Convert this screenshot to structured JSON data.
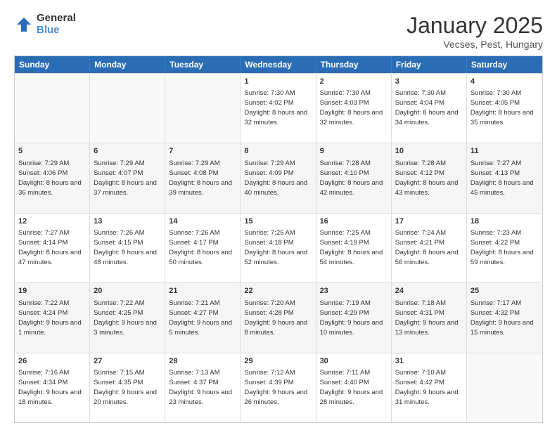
{
  "header": {
    "logo_general": "General",
    "logo_blue": "Blue",
    "month_title": "January 2025",
    "location": "Vecses, Pest, Hungary"
  },
  "days_of_week": [
    "Sunday",
    "Monday",
    "Tuesday",
    "Wednesday",
    "Thursday",
    "Friday",
    "Saturday"
  ],
  "weeks": [
    [
      {
        "day": "",
        "text": ""
      },
      {
        "day": "",
        "text": ""
      },
      {
        "day": "",
        "text": ""
      },
      {
        "day": "1",
        "text": "Sunrise: 7:30 AM\nSunset: 4:02 PM\nDaylight: 8 hours and 32 minutes."
      },
      {
        "day": "2",
        "text": "Sunrise: 7:30 AM\nSunset: 4:03 PM\nDaylight: 8 hours and 32 minutes."
      },
      {
        "day": "3",
        "text": "Sunrise: 7:30 AM\nSunset: 4:04 PM\nDaylight: 8 hours and 34 minutes."
      },
      {
        "day": "4",
        "text": "Sunrise: 7:30 AM\nSunset: 4:05 PM\nDaylight: 8 hours and 35 minutes."
      }
    ],
    [
      {
        "day": "5",
        "text": "Sunrise: 7:29 AM\nSunset: 4:06 PM\nDaylight: 8 hours and 36 minutes."
      },
      {
        "day": "6",
        "text": "Sunrise: 7:29 AM\nSunset: 4:07 PM\nDaylight: 8 hours and 37 minutes."
      },
      {
        "day": "7",
        "text": "Sunrise: 7:29 AM\nSunset: 4:08 PM\nDaylight: 8 hours and 39 minutes."
      },
      {
        "day": "8",
        "text": "Sunrise: 7:29 AM\nSunset: 4:09 PM\nDaylight: 8 hours and 40 minutes."
      },
      {
        "day": "9",
        "text": "Sunrise: 7:28 AM\nSunset: 4:10 PM\nDaylight: 8 hours and 42 minutes."
      },
      {
        "day": "10",
        "text": "Sunrise: 7:28 AM\nSunset: 4:12 PM\nDaylight: 8 hours and 43 minutes."
      },
      {
        "day": "11",
        "text": "Sunrise: 7:27 AM\nSunset: 4:13 PM\nDaylight: 8 hours and 45 minutes."
      }
    ],
    [
      {
        "day": "12",
        "text": "Sunrise: 7:27 AM\nSunset: 4:14 PM\nDaylight: 8 hours and 47 minutes."
      },
      {
        "day": "13",
        "text": "Sunrise: 7:26 AM\nSunset: 4:15 PM\nDaylight: 8 hours and 48 minutes."
      },
      {
        "day": "14",
        "text": "Sunrise: 7:26 AM\nSunset: 4:17 PM\nDaylight: 8 hours and 50 minutes."
      },
      {
        "day": "15",
        "text": "Sunrise: 7:25 AM\nSunset: 4:18 PM\nDaylight: 8 hours and 52 minutes."
      },
      {
        "day": "16",
        "text": "Sunrise: 7:25 AM\nSunset: 4:19 PM\nDaylight: 8 hours and 54 minutes."
      },
      {
        "day": "17",
        "text": "Sunrise: 7:24 AM\nSunset: 4:21 PM\nDaylight: 8 hours and 56 minutes."
      },
      {
        "day": "18",
        "text": "Sunrise: 7:23 AM\nSunset: 4:22 PM\nDaylight: 8 hours and 59 minutes."
      }
    ],
    [
      {
        "day": "19",
        "text": "Sunrise: 7:22 AM\nSunset: 4:24 PM\nDaylight: 9 hours and 1 minute."
      },
      {
        "day": "20",
        "text": "Sunrise: 7:22 AM\nSunset: 4:25 PM\nDaylight: 9 hours and 3 minutes."
      },
      {
        "day": "21",
        "text": "Sunrise: 7:21 AM\nSunset: 4:27 PM\nDaylight: 9 hours and 5 minutes."
      },
      {
        "day": "22",
        "text": "Sunrise: 7:20 AM\nSunset: 4:28 PM\nDaylight: 9 hours and 8 minutes."
      },
      {
        "day": "23",
        "text": "Sunrise: 7:19 AM\nSunset: 4:29 PM\nDaylight: 9 hours and 10 minutes."
      },
      {
        "day": "24",
        "text": "Sunrise: 7:18 AM\nSunset: 4:31 PM\nDaylight: 9 hours and 13 minutes."
      },
      {
        "day": "25",
        "text": "Sunrise: 7:17 AM\nSunset: 4:32 PM\nDaylight: 9 hours and 15 minutes."
      }
    ],
    [
      {
        "day": "26",
        "text": "Sunrise: 7:16 AM\nSunset: 4:34 PM\nDaylight: 9 hours and 18 minutes."
      },
      {
        "day": "27",
        "text": "Sunrise: 7:15 AM\nSunset: 4:35 PM\nDaylight: 9 hours and 20 minutes."
      },
      {
        "day": "28",
        "text": "Sunrise: 7:13 AM\nSunset: 4:37 PM\nDaylight: 9 hours and 23 minutes."
      },
      {
        "day": "29",
        "text": "Sunrise: 7:12 AM\nSunset: 4:39 PM\nDaylight: 9 hours and 26 minutes."
      },
      {
        "day": "30",
        "text": "Sunrise: 7:11 AM\nSunset: 4:40 PM\nDaylight: 9 hours and 28 minutes."
      },
      {
        "day": "31",
        "text": "Sunrise: 7:10 AM\nSunset: 4:42 PM\nDaylight: 9 hours and 31 minutes."
      },
      {
        "day": "",
        "text": ""
      }
    ]
  ]
}
